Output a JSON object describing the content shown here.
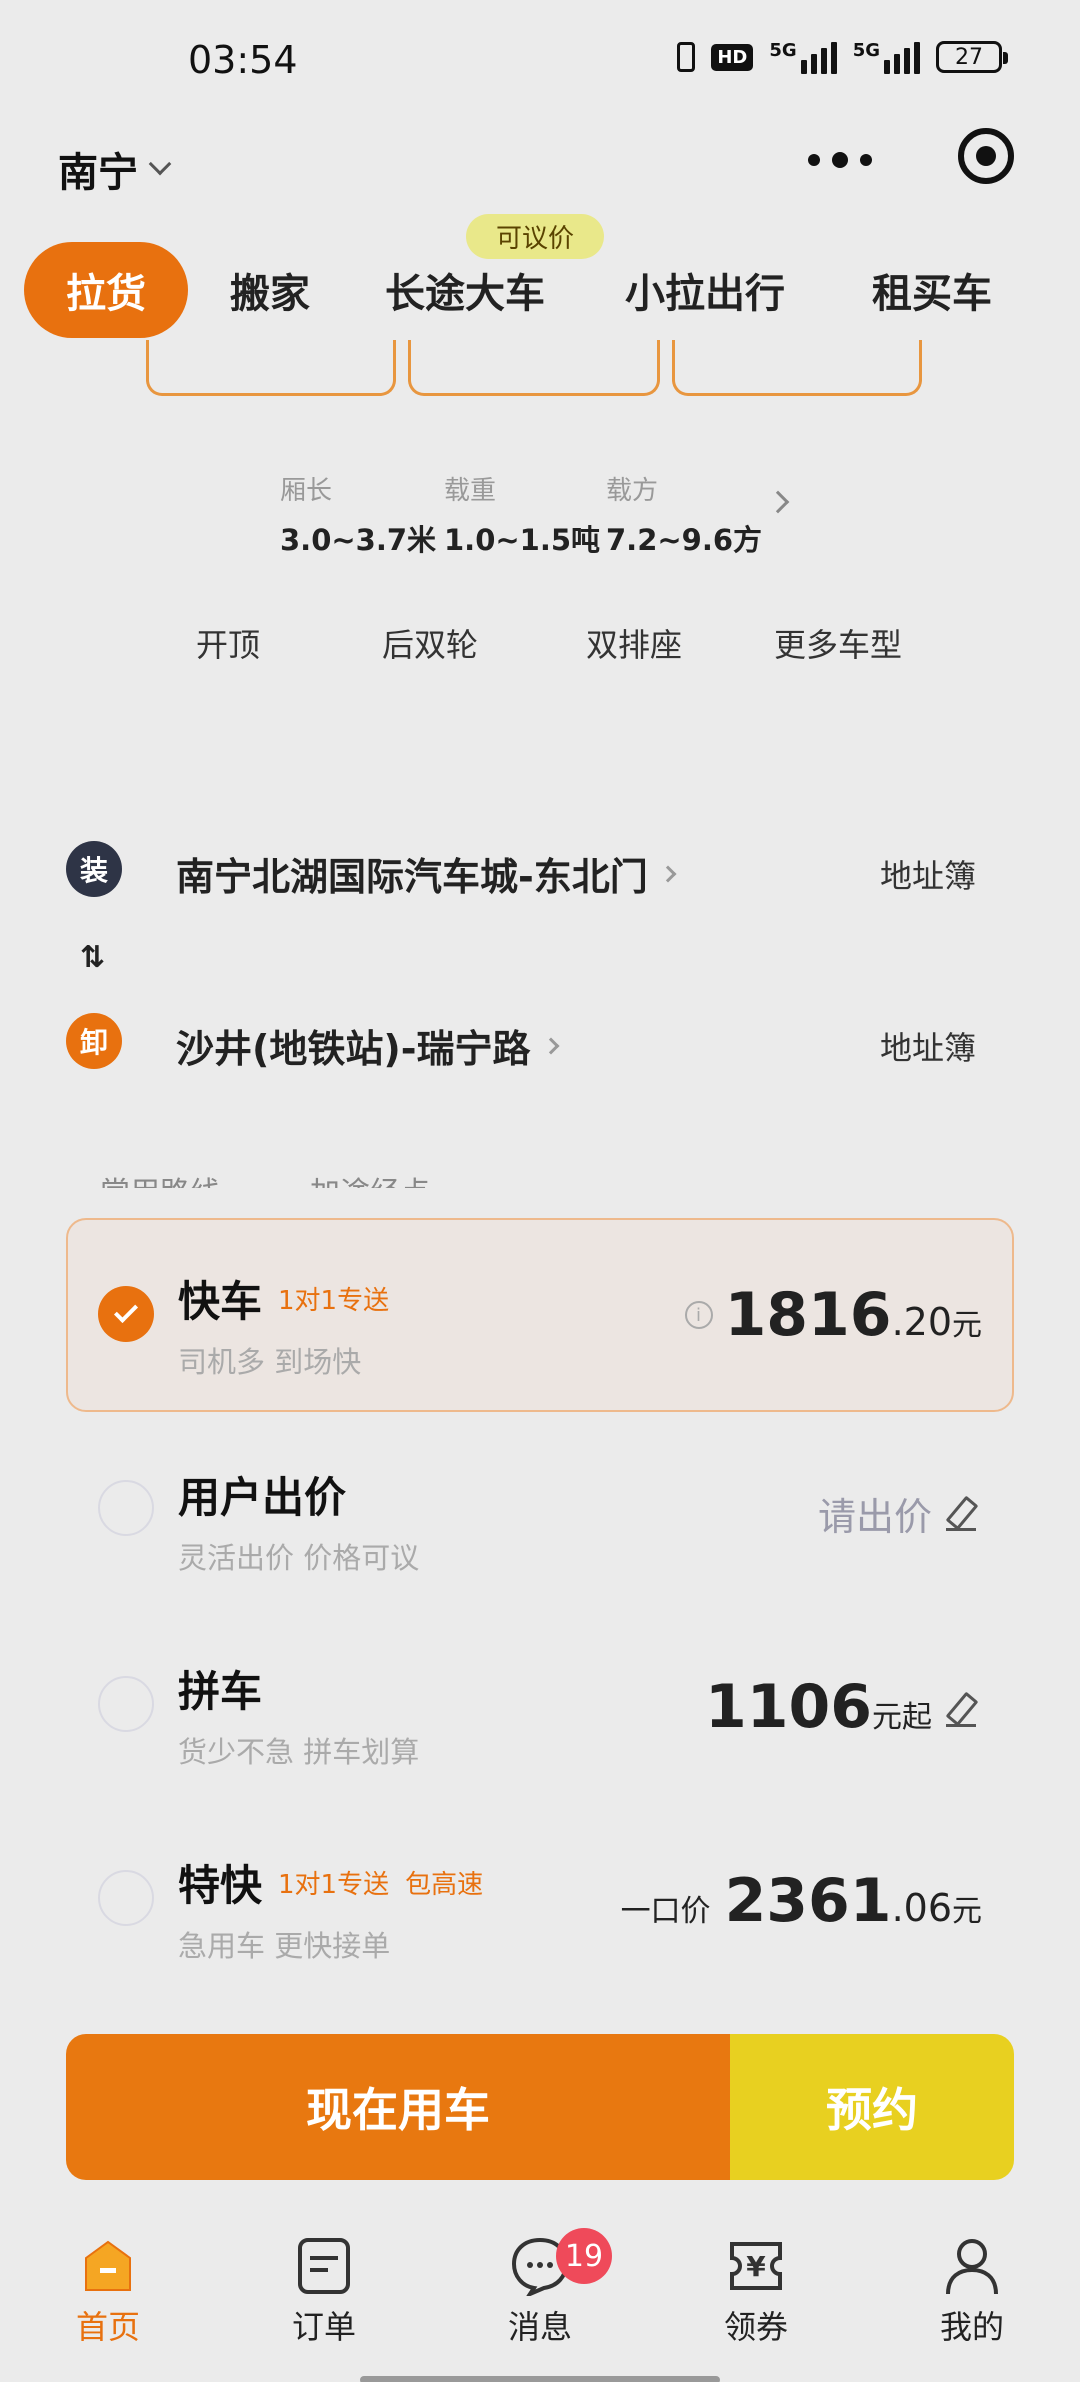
{
  "status_bar": {
    "time": "03:54",
    "network": "5G",
    "network2": "5G",
    "hd": "HD",
    "battery": "27"
  },
  "header": {
    "city": "南宁"
  },
  "tabs": [
    {
      "label": "拉货",
      "active": true
    },
    {
      "label": "搬家",
      "active": false
    },
    {
      "label": "长途大车",
      "active": false
    },
    {
      "label": "小拉出行",
      "active": false
    },
    {
      "label": "租买车",
      "active": false
    }
  ],
  "bargain_tag": "可议价",
  "vehicle_specs": [
    {
      "label": "厢长",
      "value": "3.0~3.7米"
    },
    {
      "label": "载重",
      "value": "1.0~1.5吨"
    },
    {
      "label": "载方",
      "value": "7.2~9.6方"
    }
  ],
  "vehicle_features": [
    "开顶",
    "后双轮",
    "双排座",
    "更多车型"
  ],
  "route": {
    "load": {
      "badge": "装",
      "address": "南宁北湖国际汽车城-东北门",
      "book_label": "地址簿"
    },
    "unload": {
      "badge": "卸",
      "address": "沙井(地铁站)-瑞宁路",
      "book_label": "地址簿"
    }
  },
  "clipped_row": "常用路线　　　加途经点",
  "options": [
    {
      "title": "快车",
      "tags": [
        "1对1专送"
      ],
      "subtitle": "司机多 到场快",
      "price_int": "1816",
      "price_dec": ".20",
      "unit": "元",
      "selected": true
    },
    {
      "title": "用户出价",
      "tags": [],
      "subtitle": "灵活出价 价格可议",
      "action": "请出价",
      "selected": false
    },
    {
      "title": "拼车",
      "tags": [],
      "subtitle": "货少不急 拼车划算",
      "price_int": "1106",
      "unit": "元起",
      "selected": false
    },
    {
      "title": "特快",
      "tags": [
        "1对1专送",
        "包高速"
      ],
      "subtitle": "急用车 更快接单",
      "prefix": "一口价",
      "price_int": "2361",
      "price_dec": ".06",
      "unit": "元",
      "selected": false
    }
  ],
  "buttons": {
    "now": "现在用车",
    "reserve": "预约"
  },
  "bottom_nav": [
    {
      "label": "首页",
      "icon": "home-icon",
      "active": true
    },
    {
      "label": "订单",
      "icon": "order-icon",
      "active": false
    },
    {
      "label": "消息",
      "icon": "message-icon",
      "active": false,
      "badge": "19"
    },
    {
      "label": "领券",
      "icon": "coupon-icon",
      "active": false
    },
    {
      "label": "我的",
      "icon": "profile-icon",
      "active": false
    }
  ],
  "colors": {
    "brand_orange": "#e8710f",
    "reserve_yellow": "#e8d020",
    "badge_red": "#ef4a5a"
  }
}
